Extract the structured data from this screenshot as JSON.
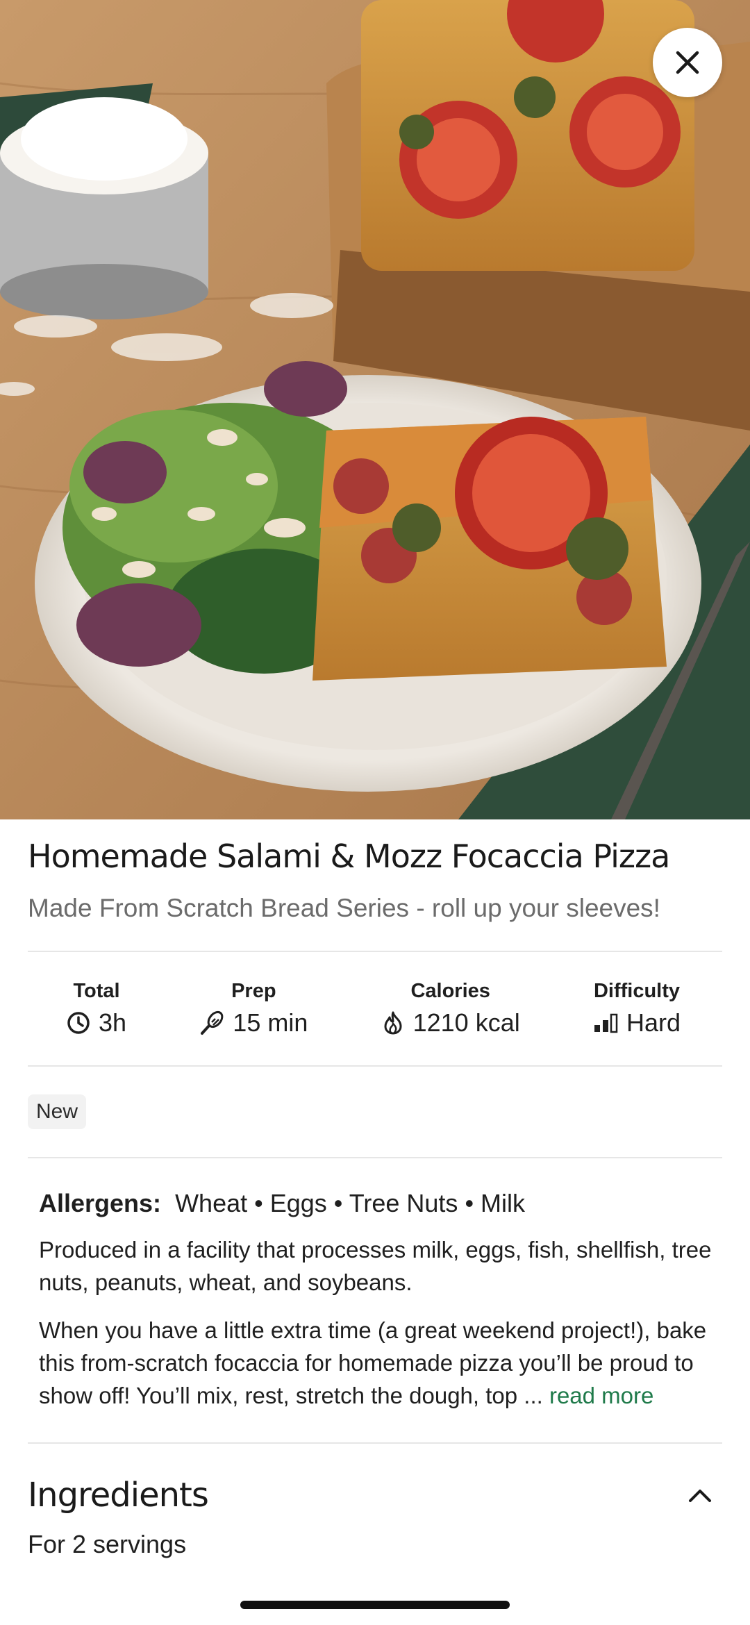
{
  "close_icon": "close-icon",
  "recipe": {
    "title": "Homemade Salami & Mozz Focaccia Pizza",
    "subtitle": "Made From Scratch Bread Series - roll up your sleeves!"
  },
  "stats": [
    {
      "label": "Total",
      "value": "3h",
      "icon": "clock-icon"
    },
    {
      "label": "Prep",
      "value": "15 min",
      "icon": "whisk-icon"
    },
    {
      "label": "Calories",
      "value": "1210 kcal",
      "icon": "flame-icon"
    },
    {
      "label": "Difficulty",
      "value": "Hard",
      "icon": "difficulty-bars-icon"
    }
  ],
  "tag": "New",
  "allergens": {
    "label": "Allergens:",
    "list": "Wheat • Eggs • Tree Nuts • Milk",
    "facility_note": "Produced in a facility that processes milk, eggs, fish, shellfish, tree nuts, peanuts, wheat, and soybeans."
  },
  "description": {
    "text": "When you have a little extra time (a great weekend project!), bake this from-scratch focaccia for homemade pizza you’ll be proud to show off! You’ll mix, rest, stretch the dough, top ...",
    "read_more": "read more"
  },
  "ingredients": {
    "title": "Ingredients",
    "servings": "For 2 servings",
    "toggle_icon": "chevron-up-icon"
  },
  "colors": {
    "accent_green": "#1f7a4a",
    "subtitle_gray": "#6b6b6b"
  }
}
